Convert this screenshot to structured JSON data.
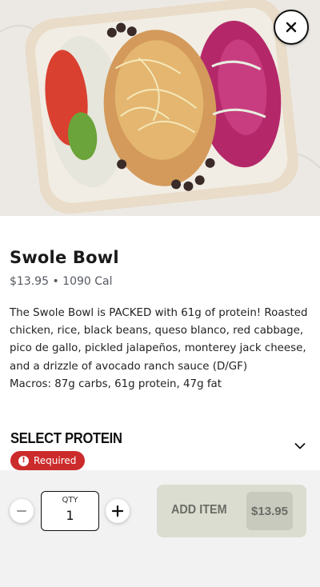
{
  "product": {
    "image_alt": "Swole Bowl",
    "title": "Swole Bowl",
    "price": "$13.95",
    "separator": "•",
    "calories": "1090 Cal",
    "description_lines": [
      "The Swole Bowl is PACKED with 61g of protein! Roasted",
      "chicken, rice, black beans, queso blanco, red cabbage,",
      "pico de gallo, pickled jalapeños, monterey jack cheese,",
      "and a drizzle of avocado ranch sauce (D/GF)",
      "Macros: 87g carbs, 61g protein, 47g fat"
    ]
  },
  "options": {
    "section_title": "SELECT PROTEIN",
    "required_label": "Required",
    "required_icon": "exclamation-icon",
    "expand_icon": "chevron-down-icon"
  },
  "cart": {
    "qty_label": "QTY",
    "qty_value": "1",
    "minus_icon": "minus-icon",
    "plus_icon": "plus-icon",
    "add_label": "ADD ITEM",
    "add_price": "$13.95"
  },
  "icons": {
    "close": "close-icon"
  },
  "colors": {
    "required": "#cc2b2b",
    "add_button": "#dbddd0",
    "add_price_bg": "#c8cabd"
  }
}
